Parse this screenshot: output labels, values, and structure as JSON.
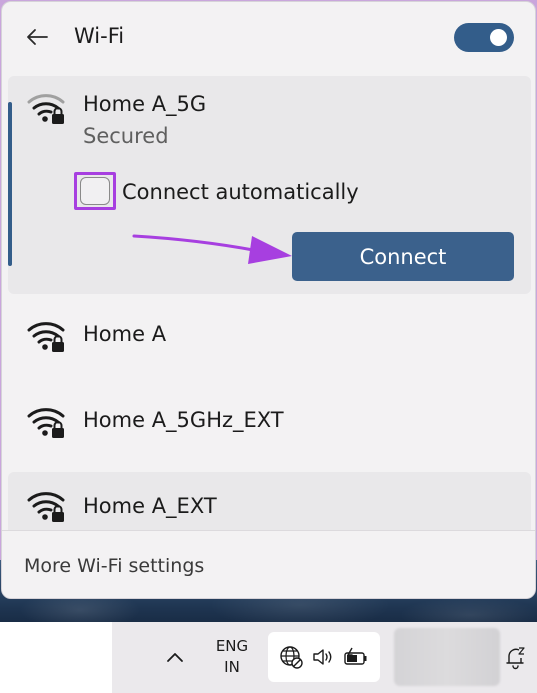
{
  "header": {
    "title": "Wi-Fi",
    "toggle_on": true
  },
  "networks": [
    {
      "name": "Home A_5G",
      "status": "Secured",
      "secured": true,
      "expanded": true,
      "connect_automatically_label": "Connect automatically",
      "connect_automatically_checked": false,
      "connect_label": "Connect"
    },
    {
      "name": "Home A",
      "secured": true
    },
    {
      "name": "Home A_5GHz_EXT",
      "secured": true
    },
    {
      "name": "Home A_EXT",
      "secured": true
    }
  ],
  "footer": {
    "more_settings_label": "More Wi-Fi settings"
  },
  "taskbar": {
    "lang_line1": "ENG",
    "lang_line2": "IN",
    "tray_icons": [
      "globe-blocked-icon",
      "speaker-icon",
      "battery-charging-icon"
    ],
    "notification_icon": "notification-snooze-icon"
  },
  "colors": {
    "accent": "#335d8a",
    "button": "#3b618c",
    "highlight": "#a73fe0",
    "background": "#c9a6dc"
  }
}
